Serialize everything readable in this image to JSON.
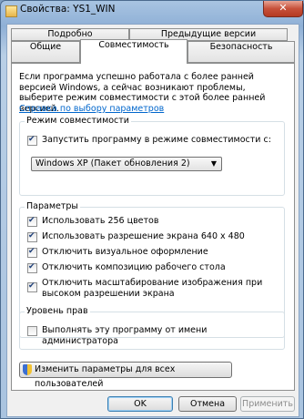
{
  "window": {
    "title": "Свойства: YS1_WIN",
    "close_symbol": "✕"
  },
  "tabs": {
    "row1": [
      "Подробно",
      "Предыдущие версии"
    ],
    "row2": [
      "Общие",
      "Совместимость",
      "Безопасность"
    ],
    "active": "Совместимость"
  },
  "intro_text": "Если программа успешно работала с более ранней версией Windows, а сейчас возникают проблемы, выберите режим совместимости с этой более ранней версией.",
  "help_link": "Справка по выбору параметров",
  "compat_mode": {
    "title": "Режим совместимости",
    "checkbox_label": "Запустить программу в режиме совместимости с:",
    "checked": true,
    "selected_os": "Windows XP (Пакет обновления 2)"
  },
  "settings": {
    "title": "Параметры",
    "items": [
      {
        "label": "Использовать 256 цветов",
        "checked": true
      },
      {
        "label": "Использовать разрешение экрана 640 x 480",
        "checked": true
      },
      {
        "label": "Отключить визуальное оформление",
        "checked": true
      },
      {
        "label": "Отключить композицию рабочего стола",
        "checked": true
      },
      {
        "label": "Отключить масштабирование изображения при высоком разрешении экрана",
        "checked": true
      }
    ]
  },
  "privilege": {
    "title": "Уровень прав",
    "checkbox_label": "Выполнять эту программу от имени администратора",
    "checked": false
  },
  "all_users_button": "Изменить параметры для всех пользователей",
  "buttons": {
    "ok": "OK",
    "cancel": "Отмена",
    "apply": "Применить"
  }
}
